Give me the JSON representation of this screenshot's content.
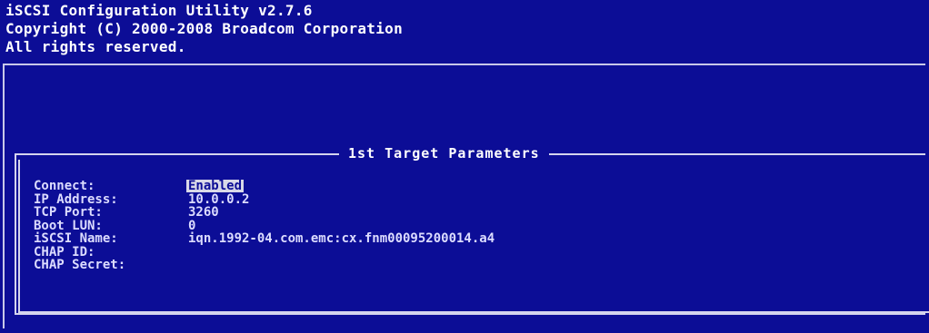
{
  "header": {
    "title_line": "iSCSI Configuration Utility v2.7.6",
    "copyright_line": "Copyright (C) 2000-2008 Broadcom Corporation",
    "rights_line": "All rights reserved."
  },
  "panel": {
    "title": "1st Target Parameters"
  },
  "fields": [
    {
      "label": "Connect:",
      "value": "Enabled"
    },
    {
      "label": "IP Address:",
      "value": "10.0.0.2"
    },
    {
      "label": "TCP Port:",
      "value": "3260"
    },
    {
      "label": "Boot LUN:",
      "value": "0"
    },
    {
      "label": "iSCSI Name:",
      "value": "iqn.1992-04.com.emc:cx.fnm00095200014.a4"
    },
    {
      "label": "CHAP ID:",
      "value": ""
    },
    {
      "label": "CHAP Secret:",
      "value": ""
    }
  ],
  "colors": {
    "background": "#0c0d96",
    "text": "#dcdcff",
    "highlight": "#d8d8e8"
  }
}
